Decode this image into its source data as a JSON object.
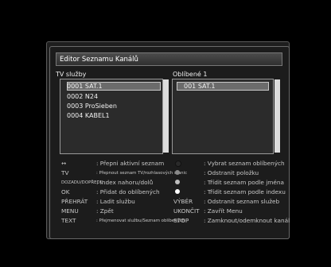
{
  "window": {
    "title": "Editor Seznamu Kanálů"
  },
  "left_list": {
    "label": "TV služby",
    "items": [
      "0001 SAT.1",
      "0002 N24",
      "0003 ProSieben",
      "0004 KABEL1"
    ],
    "selected_index": 0
  },
  "right_list": {
    "label": "Oblíbené 1",
    "items": [
      "001 SAT.1"
    ],
    "selected_index": 0
  },
  "help": {
    "left": [
      {
        "key": "↔",
        "desc": ": Přepni aktivní seznam"
      },
      {
        "key": "TV",
        "desc": ": Přepnout seznam TV/rozhlasových stanic"
      },
      {
        "key": "DOZADU/DOPŘEDU",
        "desc": ": Index nahoru/dolů"
      },
      {
        "key": "OK",
        "desc": ": Přidat do oblíbených"
      },
      {
        "key": "PŘEHRÁT",
        "desc": ": Ladit službu"
      },
      {
        "key": "MENU",
        "desc": ": Zpět"
      },
      {
        "key": "TEXT",
        "desc": ": Přejmenovat službu/Seznam oblíbených"
      }
    ],
    "right": [
      {
        "key": "",
        "desc": ": Vybrat seznam oblíbených",
        "color": "#2a2a2a"
      },
      {
        "key": "",
        "desc": ": Odstranit položku",
        "color": "#8a8a8a"
      },
      {
        "key": "",
        "desc": ": Třídit seznam podle jména",
        "color": "#bdbdbd"
      },
      {
        "key": "",
        "desc": ": Třídit seznam podle indexu",
        "color": "#ffffff"
      },
      {
        "key": "VÝBĚR",
        "desc": ": Odstranit seznam služeb"
      },
      {
        "key": "UKONČIT",
        "desc": ": Zavřít Menu"
      },
      {
        "key": "STOP",
        "desc": ": Zamknout/odemknout kanál"
      }
    ]
  }
}
